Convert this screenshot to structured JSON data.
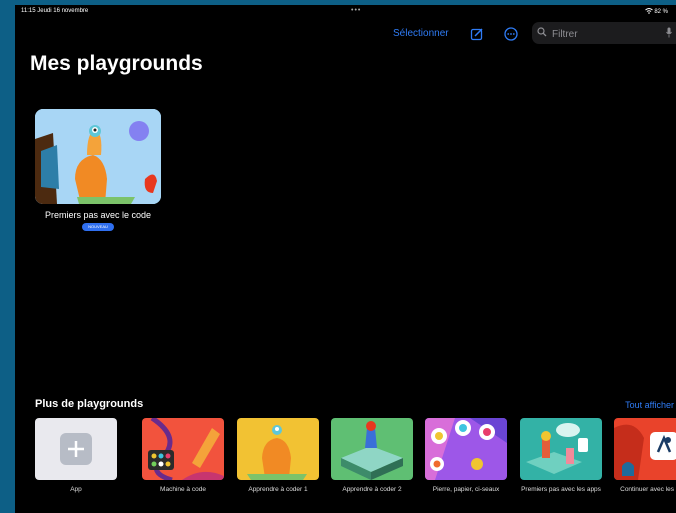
{
  "status": {
    "time_date": "11:15  Jeudi 16 novembre",
    "dots": "•••",
    "battery": "82 %"
  },
  "toolbar": {
    "select_label": "Sélectionner",
    "search_placeholder": "Filtrer"
  },
  "page_title": "Mes playgrounds",
  "my_playgrounds": [
    {
      "name": "Premiers pas avec le code",
      "badge": "NOUVEAU"
    }
  ],
  "more": {
    "title": "Plus de playgrounds",
    "see_all": "Tout afficher",
    "items": [
      {
        "label": "App"
      },
      {
        "label": "Machine à code"
      },
      {
        "label": "Apprendre à coder 1"
      },
      {
        "label": "Apprendre à coder 2"
      },
      {
        "label": "Pierre, papier, ci-seaux"
      },
      {
        "label": "Premiers pas avec les apps"
      },
      {
        "label": "Continuer avec les apps"
      }
    ]
  },
  "colors": {
    "accent": "#2f7cf6",
    "background": "#000000",
    "bezel": "#0d5f86"
  }
}
